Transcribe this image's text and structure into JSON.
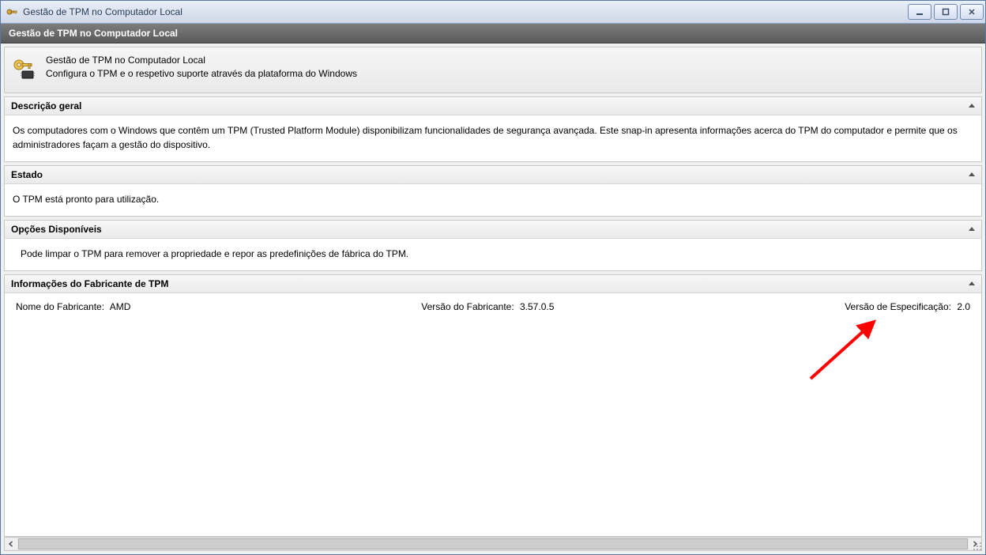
{
  "window": {
    "title": "Gestão de TPM no Computador Local"
  },
  "subheader": {
    "title": "Gestão de TPM no Computador Local"
  },
  "intro": {
    "line1": "Gestão de TPM no Computador Local",
    "line2": "Configura o TPM e o respetivo suporte através da plataforma do Windows"
  },
  "sections": {
    "overview": {
      "title": "Descrição geral",
      "body": "Os computadores com o Windows que contêm um TPM (Trusted Platform Module) disponibilizam funcionalidades de segurança avançada. Este snap-in apresenta informações acerca do TPM do computador e permite que os administradores façam a gestão do dispositivo."
    },
    "status": {
      "title": "Estado",
      "body": "O TPM está pronto para utilização."
    },
    "options": {
      "title": "Opções Disponíveis",
      "body": "Pode limpar o TPM para remover a propriedade e repor as predefinições de fábrica do TPM."
    },
    "manufacturer": {
      "title": "Informações do Fabricante de TPM",
      "name_label": "Nome do Fabricante:",
      "name_value": "AMD",
      "version_label": "Versão do Fabricante:",
      "version_value": "3.57.0.5",
      "spec_label": "Versão de Especificação:",
      "spec_value": "2.0"
    }
  }
}
